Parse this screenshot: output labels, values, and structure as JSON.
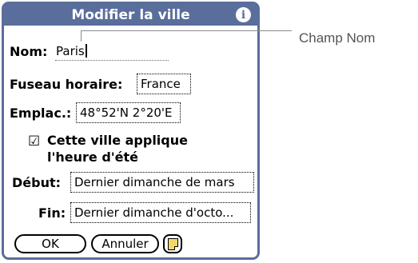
{
  "dialog": {
    "title": "Modifier la ville",
    "info_glyph": "i",
    "name_label": "Nom:",
    "name_value": "Paris",
    "timezone_label": "Fuseau horaire:",
    "timezone_value": "France",
    "location_label": "Emplac.:",
    "location_value": "48°52'N 2°20'E",
    "dst_checked": true,
    "dst_label_line1": "Cette ville applique",
    "dst_label_line2": "l'heure d'été",
    "start_label": "Début:",
    "start_value": "Dernier dimanche de mars",
    "end_label": "Fin:",
    "end_value": "Dernier dimanche d'octo...",
    "ok_label": "OK",
    "cancel_label": "Annuler",
    "note_icon": "note-icon"
  },
  "callout": {
    "text": "Champ Nom"
  },
  "colors": {
    "title_bar": "#5a6e9b",
    "note_fill": "#f4d76a",
    "callout": "#8a8a8a"
  }
}
